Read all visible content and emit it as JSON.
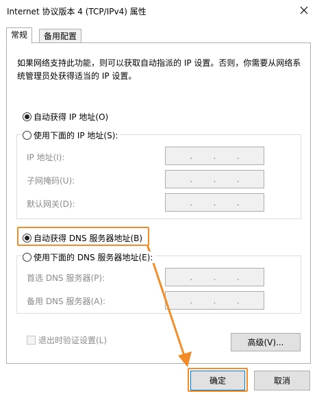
{
  "window": {
    "title": "Internet 协议版本 4 (TCP/IPv4) 属性",
    "close_label": "✕"
  },
  "tabs": [
    {
      "label": "常规",
      "active": true
    },
    {
      "label": "备用配置",
      "active": false
    }
  ],
  "description": "如果网络支持此功能，则可以获取自动指派的 IP 设置。否则，你需要从网络系统管理员处获得适当的 IP 设置。",
  "ip_section": {
    "auto_label": "自动获得 IP 地址(O)",
    "auto_checked": true,
    "manual_label": "使用下面的 IP 地址(S):",
    "manual_checked": false,
    "fields": [
      {
        "label": "IP 地址(I):",
        "value": ".  .  ."
      },
      {
        "label": "子网掩码(U):",
        "value": ".  .  ."
      },
      {
        "label": "默认网关(D):",
        "value": ".  .  ."
      }
    ]
  },
  "dns_section": {
    "auto_label": "自动获得 DNS 服务器地址(B)",
    "auto_checked": true,
    "manual_label": "使用下面的 DNS 服务器地址(E):",
    "manual_checked": false,
    "fields": [
      {
        "label": "首选 DNS 服务器(P):",
        "value": ".  .  ."
      },
      {
        "label": "备用 DNS 服务器(A):",
        "value": ".  .  ."
      }
    ]
  },
  "validate_checkbox": {
    "label": "退出时验证设置(L)",
    "checked": false
  },
  "buttons": {
    "advanced": "高级(V)...",
    "ok": "确定",
    "cancel": "取消"
  },
  "annotation_color": "#f28c28"
}
